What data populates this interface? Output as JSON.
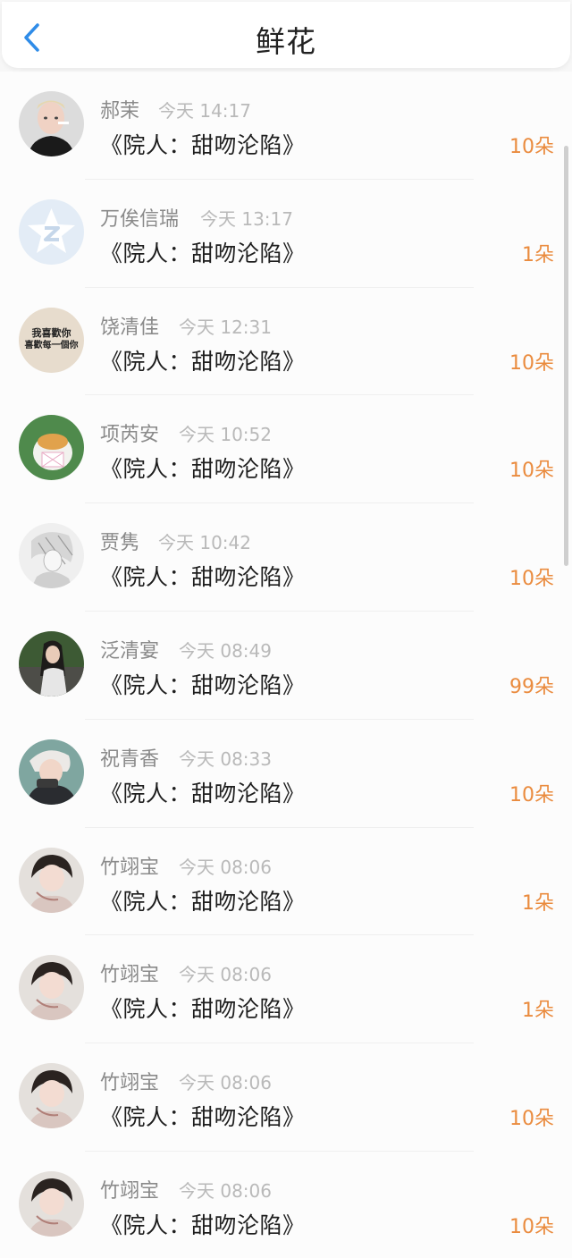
{
  "header": {
    "title": "鲜花",
    "back_icon": "chevron-left-icon",
    "accent": "#2f8ce8"
  },
  "items": [
    {
      "name": "郝茉",
      "time": "今天 14:17",
      "work": "《院人：甜吻沦陷》",
      "count": "10朵",
      "avatar": "person-photo"
    },
    {
      "name": "万俟信瑞",
      "time": "今天 13:17",
      "work": "《院人：甜吻沦陷》",
      "count": "1朵",
      "avatar": "default-star-avatar"
    },
    {
      "name": "饶清佳",
      "time": "今天 12:31",
      "work": "《院人：甜吻沦陷》",
      "count": "10朵",
      "avatar": "text-avatar",
      "avatar_text": [
        "我喜歡你",
        "喜歡每一個你"
      ]
    },
    {
      "name": "项芮安",
      "time": "今天 10:52",
      "work": "《院人：甜吻沦陷》",
      "count": "10朵",
      "avatar": "cat-avatar"
    },
    {
      "name": "贾隽",
      "time": "今天 10:42",
      "work": "《院人：甜吻沦陷》",
      "count": "10朵",
      "avatar": "sketch-avatar"
    },
    {
      "name": "泛清宴",
      "time": "今天 08:49",
      "work": "《院人：甜吻沦陷》",
      "count": "99朵",
      "avatar": "girl-photo"
    },
    {
      "name": "祝青香",
      "time": "今天 08:33",
      "work": "《院人：甜吻沦陷》",
      "count": "10朵",
      "avatar": "boy-photo"
    },
    {
      "name": "竹翊宝",
      "time": "今天 08:06",
      "work": "《院人：甜吻沦陷》",
      "count": "1朵",
      "avatar": "anime-boy"
    },
    {
      "name": "竹翊宝",
      "time": "今天 08:06",
      "work": "《院人：甜吻沦陷》",
      "count": "1朵",
      "avatar": "anime-boy"
    },
    {
      "name": "竹翊宝",
      "time": "今天 08:06",
      "work": "《院人：甜吻沦陷》",
      "count": "10朵",
      "avatar": "anime-boy"
    },
    {
      "name": "竹翊宝",
      "time": "今天 08:06",
      "work": "《院人：甜吻沦陷》",
      "count": "10朵",
      "avatar": "anime-boy"
    }
  ],
  "colors": {
    "count": "#ea8b3e",
    "name": "#8a8a8a",
    "time": "#b9b9b9"
  }
}
